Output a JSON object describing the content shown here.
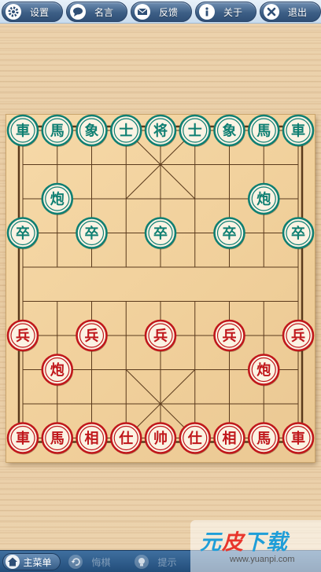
{
  "toolbar": {
    "items": [
      {
        "label": "设置",
        "icon": "gear-icon"
      },
      {
        "label": "名言",
        "icon": "speech-bubble-icon"
      },
      {
        "label": "反馈",
        "icon": "envelope-icon"
      },
      {
        "label": "关于",
        "icon": "info-icon"
      },
      {
        "label": "退出",
        "icon": "close-icon"
      }
    ]
  },
  "board": {
    "river_left": "",
    "river_right": "",
    "colors": {
      "grid": "#5a3a1c",
      "green_piece": "#0f7f72",
      "red_piece": "#c0171b"
    },
    "pieces": [
      {
        "char": "車",
        "side": "green",
        "file": 0,
        "rank": 0
      },
      {
        "char": "馬",
        "side": "green",
        "file": 1,
        "rank": 0
      },
      {
        "char": "象",
        "side": "green",
        "file": 2,
        "rank": 0
      },
      {
        "char": "士",
        "side": "green",
        "file": 3,
        "rank": 0
      },
      {
        "char": "将",
        "side": "green",
        "file": 4,
        "rank": 0
      },
      {
        "char": "士",
        "side": "green",
        "file": 5,
        "rank": 0
      },
      {
        "char": "象",
        "side": "green",
        "file": 6,
        "rank": 0
      },
      {
        "char": "馬",
        "side": "green",
        "file": 7,
        "rank": 0
      },
      {
        "char": "車",
        "side": "green",
        "file": 8,
        "rank": 0
      },
      {
        "char": "炮",
        "side": "green",
        "file": 1,
        "rank": 2
      },
      {
        "char": "炮",
        "side": "green",
        "file": 7,
        "rank": 2
      },
      {
        "char": "卒",
        "side": "green",
        "file": 0,
        "rank": 3
      },
      {
        "char": "卒",
        "side": "green",
        "file": 2,
        "rank": 3
      },
      {
        "char": "卒",
        "side": "green",
        "file": 4,
        "rank": 3
      },
      {
        "char": "卒",
        "side": "green",
        "file": 6,
        "rank": 3
      },
      {
        "char": "卒",
        "side": "green",
        "file": 8,
        "rank": 3
      },
      {
        "char": "兵",
        "side": "red",
        "file": 0,
        "rank": 6
      },
      {
        "char": "兵",
        "side": "red",
        "file": 2,
        "rank": 6
      },
      {
        "char": "兵",
        "side": "red",
        "file": 4,
        "rank": 6
      },
      {
        "char": "兵",
        "side": "red",
        "file": 6,
        "rank": 6
      },
      {
        "char": "兵",
        "side": "red",
        "file": 8,
        "rank": 6
      },
      {
        "char": "炮",
        "side": "red",
        "file": 1,
        "rank": 7
      },
      {
        "char": "炮",
        "side": "red",
        "file": 7,
        "rank": 7
      },
      {
        "char": "車",
        "side": "red",
        "file": 0,
        "rank": 9
      },
      {
        "char": "馬",
        "side": "red",
        "file": 1,
        "rank": 9
      },
      {
        "char": "相",
        "side": "red",
        "file": 2,
        "rank": 9
      },
      {
        "char": "仕",
        "side": "red",
        "file": 3,
        "rank": 9
      },
      {
        "char": "帅",
        "side": "red",
        "file": 4,
        "rank": 9
      },
      {
        "char": "仕",
        "side": "red",
        "file": 5,
        "rank": 9
      },
      {
        "char": "相",
        "side": "red",
        "file": 6,
        "rank": 9
      },
      {
        "char": "馬",
        "side": "red",
        "file": 7,
        "rank": 9
      },
      {
        "char": "車",
        "side": "red",
        "file": 8,
        "rank": 9
      }
    ]
  },
  "bottombar": {
    "main_menu": "主菜单",
    "undo": "悔棋",
    "hint": "提示"
  },
  "watermark": {
    "title_part1": "元",
    "title_part2": "皮",
    "title_part3": "下",
    "title_part4": "载",
    "url": "www.yuanpi.com"
  }
}
